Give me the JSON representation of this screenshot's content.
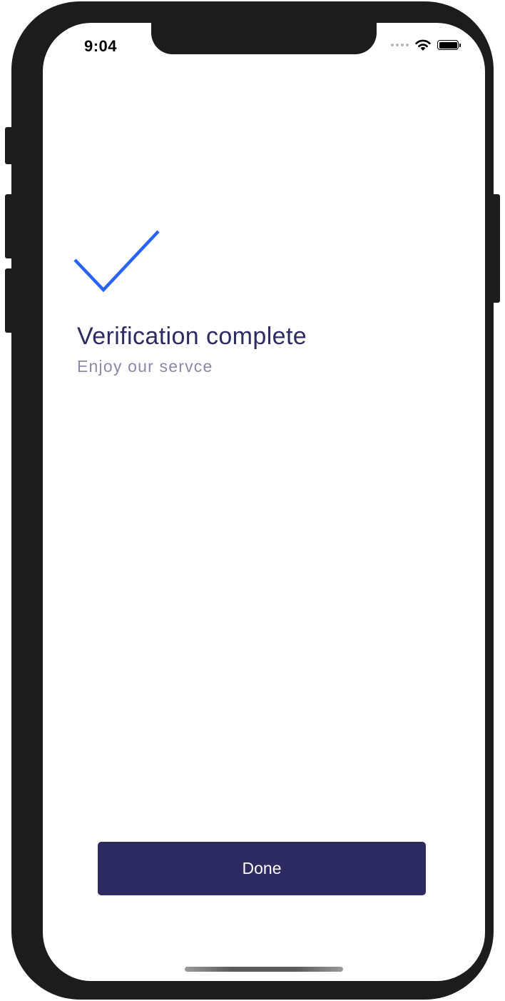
{
  "status_bar": {
    "time": "9:04",
    "icons": [
      "signal-dots-icon",
      "wifi-icon",
      "battery-icon"
    ]
  },
  "main": {
    "icon": "checkmark-icon",
    "title": "Verification complete",
    "subtitle": "Enjoy our servce"
  },
  "actions": {
    "done_label": "Done"
  },
  "colors": {
    "accent": "#2962f5",
    "primary": "#2d2b62",
    "subtitle": "#8a89a6",
    "device_frame": "#1c1c1c"
  }
}
